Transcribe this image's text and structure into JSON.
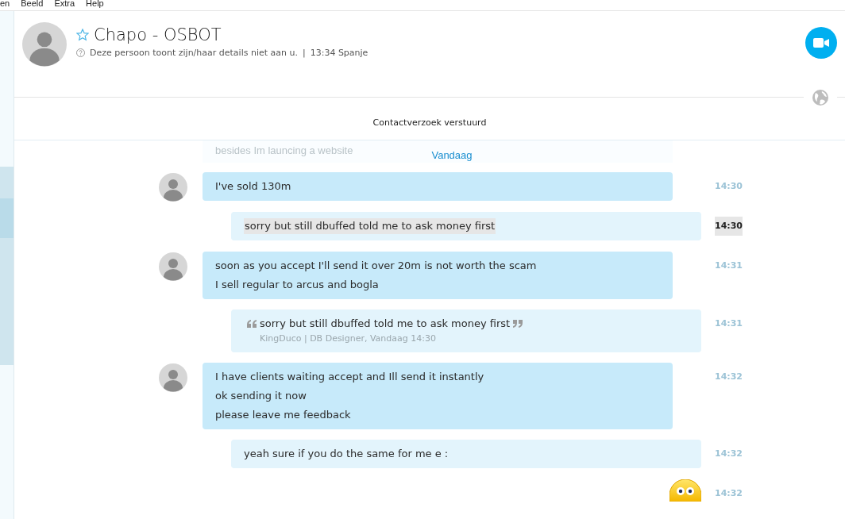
{
  "menu": [
    "en",
    "Beeld",
    "Extra",
    "Help"
  ],
  "contact": {
    "name": "Chapo - OSBOT",
    "favorite": false,
    "status": "Deze persoon toont zijn/haar details niet aan u.",
    "separator": "|",
    "local_time": "13:34 Spanje"
  },
  "notice": "Contactverzoek verstuurd",
  "faded_message": "besides Im launcing a website",
  "day_label": "Vandaag",
  "messages": [
    {
      "kind": "incoming",
      "lines": [
        "I've sold 130m"
      ],
      "time": "14:30",
      "highlighted": false
    },
    {
      "kind": "outgoing",
      "lines": [
        "sorry but still dbuffed told me to ask money first"
      ],
      "time": "14:30",
      "highlighted": true
    },
    {
      "kind": "incoming",
      "lines": [
        "soon as you accept I'll send it over 20m is not worth the scam",
        "I sell regular to arcus and bogla"
      ],
      "time": "14:31",
      "highlighted": false
    },
    {
      "kind": "quote",
      "lines": [
        "sorry but still dbuffed told me to ask money first"
      ],
      "attribution": "KingDuco | DB Designer, Vandaag 14:30",
      "time": "14:31",
      "highlighted": false
    },
    {
      "kind": "incoming",
      "lines": [
        "I have clients waiting accept and Ill send it instantly",
        "ok sending it now",
        "please leave me feedback"
      ],
      "time": "14:32",
      "highlighted": false
    },
    {
      "kind": "outgoing",
      "lines": [
        "yeah sure if you do the same for me e :"
      ],
      "time": "14:32",
      "highlighted": false
    },
    {
      "kind": "emoticon",
      "time": "14:32",
      "highlighted": false
    }
  ]
}
